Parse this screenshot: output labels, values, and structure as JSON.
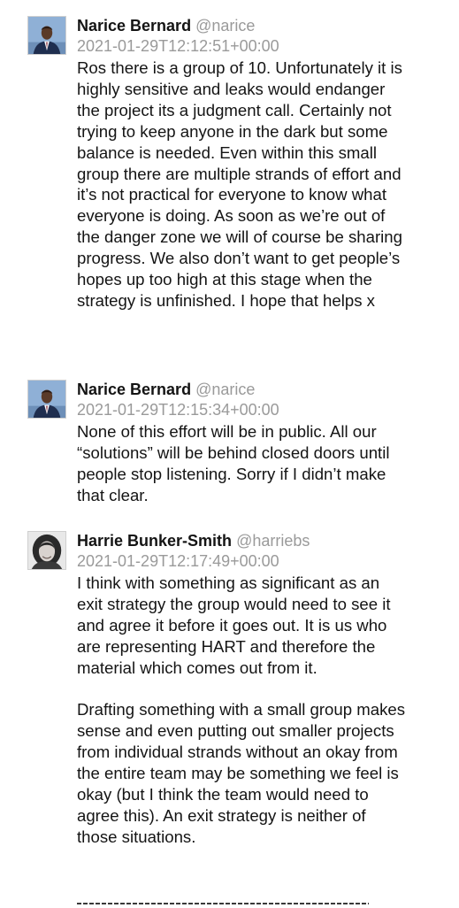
{
  "posts": [
    {
      "author": "Narice Bernard",
      "handle": "@narice",
      "timestamp": "2021-01-29T12:12:51+00:00",
      "avatar_icon": "user-avatar-man-suit",
      "paragraphs": [
        "Ros there is a group of 10. Unfortunately it is highly sensitive and leaks would endanger the project its a judgment call. Certainly not trying to keep anyone in the dark but some balance is needed. Even within this small group there are multiple strands of effort and it’s not practical for everyone to know what everyone is doing. As soon as we’re out of the danger zone we will of course be sharing progress. We also don’t want to get people’s hopes up too high at this stage when the strategy is unfinished. I hope that helps x"
      ]
    },
    {
      "author": "Narice Bernard",
      "handle": "@narice",
      "timestamp": "2021-01-29T12:15:34+00:00",
      "avatar_icon": "user-avatar-man-suit",
      "paragraphs": [
        "None of this effort will be in public. All our “solutions” will be behind closed doors until people stop listening. Sorry if I didn’t make that clear."
      ]
    },
    {
      "author": "Harrie Bunker-Smith",
      "handle": "@harriebs",
      "timestamp": "2021-01-29T12:17:49+00:00",
      "avatar_icon": "user-avatar-woman",
      "paragraphs": [
        "I think with something as significant as an exit strategy the group would need to see it and agree it before it goes out. It is us who are representing HART and therefore the material which comes out from it.",
        "Drafting something with a small group makes sense and even putting out smaller projects from individual strands without an okay from the entire team may be something we feel is okay (but I think the team would need to agree this). An exit strategy is neither of those situations."
      ]
    }
  ]
}
